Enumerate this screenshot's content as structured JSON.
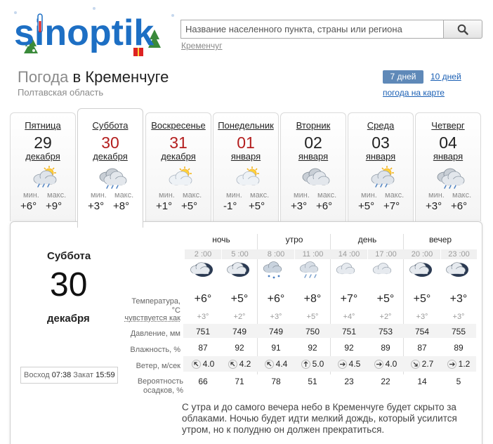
{
  "header": {
    "logo_text": "sinoptik",
    "search_placeholder": "Название населенного пункта, страны или региона",
    "city_hint": "Кременчуг"
  },
  "title": {
    "weather_word": "Погода",
    "location": "в Кременчуге",
    "region": "Полтавская область"
  },
  "nav": {
    "tab_7": "7 дней",
    "tab_10": "10 дней",
    "map_link": "погода на карте"
  },
  "labels": {
    "min": "мин.",
    "max": "макс."
  },
  "days": [
    {
      "name": "Пятница",
      "num": "29",
      "month": "декабря",
      "min": "+6°",
      "max": "+9°",
      "icon": "sun-cloud-rain-icon",
      "red": false,
      "active": false
    },
    {
      "name": "Суббота",
      "num": "30",
      "month": "декабря",
      "min": "+3°",
      "max": "+8°",
      "icon": "cloud-rain-icon",
      "red": true,
      "active": true
    },
    {
      "name": "Воскресенье",
      "num": "31",
      "month": "декабря",
      "min": "+1°",
      "max": "+5°",
      "icon": "sun-cloud-icon",
      "red": true,
      "active": false
    },
    {
      "name": "Понедельник",
      "num": "01",
      "month": "января",
      "min": "-1°",
      "max": "+5°",
      "icon": "sun-cloud-icon",
      "red": true,
      "active": false
    },
    {
      "name": "Вторник",
      "num": "02",
      "month": "января",
      "min": "+3°",
      "max": "+6°",
      "icon": "cloud-icon",
      "red": false,
      "active": false
    },
    {
      "name": "Среда",
      "num": "03",
      "month": "января",
      "min": "+5°",
      "max": "+7°",
      "icon": "sun-cloud-rain-icon",
      "red": false,
      "active": false
    },
    {
      "name": "Четверг",
      "num": "04",
      "month": "января",
      "min": "+3°",
      "max": "+6°",
      "icon": "cloud-rain-icon",
      "red": false,
      "active": false
    }
  ],
  "selected": {
    "name": "Суббота",
    "num": "30",
    "month": "декабря",
    "sunrise_label": "Восход",
    "sunrise": "07:38",
    "sunset_label": "Закат",
    "sunset": "15:59"
  },
  "detail": {
    "periods": [
      "ночь",
      "утро",
      "день",
      "вечер"
    ],
    "times": [
      "2 :00",
      "5 :00",
      "8 :00",
      "11 :00",
      "14 :00",
      "17 :00",
      "20 :00",
      "23 :00"
    ],
    "icons": [
      "night-cloud-icon",
      "night-cloud-icon",
      "cloud-snow-icon",
      "cloud-rain-icon",
      "cloud-icon",
      "cloud-icon",
      "night-cloud-icon",
      "night-cloud-icon"
    ],
    "row_labels": {
      "temp": "Температура, °C",
      "feels": "чувствуется как",
      "pressure": "Давление, мм",
      "humidity": "Влажность, %",
      "wind": "Ветер, м/сек",
      "precip": "Вероятность осадков, %"
    },
    "temp": [
      "+6°",
      "+5°",
      "+6°",
      "+8°",
      "+7°",
      "+5°",
      "+5°",
      "+3°"
    ],
    "feels": [
      "+3°",
      "+2°",
      "+3°",
      "+5°",
      "+4°",
      "+2°",
      "+3°",
      "+3°"
    ],
    "pressure": [
      "751",
      "749",
      "749",
      "750",
      "751",
      "753",
      "754",
      "755"
    ],
    "humidity": [
      "87",
      "92",
      "91",
      "92",
      "92",
      "89",
      "87",
      "89"
    ],
    "wind": [
      "4.0",
      "4.2",
      "4.4",
      "5.0",
      "4.5",
      "4.0",
      "2.7",
      "1.2"
    ],
    "wind_dir": [
      "nw",
      "nw",
      "nw",
      "n",
      "e",
      "e",
      "se",
      "e"
    ],
    "precip": [
      "66",
      "71",
      "78",
      "51",
      "23",
      "22",
      "14",
      "5"
    ]
  },
  "description": "С утра и до самого вечера небо в Кременчуге будет скрыто за облаками. Ночью будет идти мелкий дождь, который усилится утром, но к полудню он должен прекратиться."
}
